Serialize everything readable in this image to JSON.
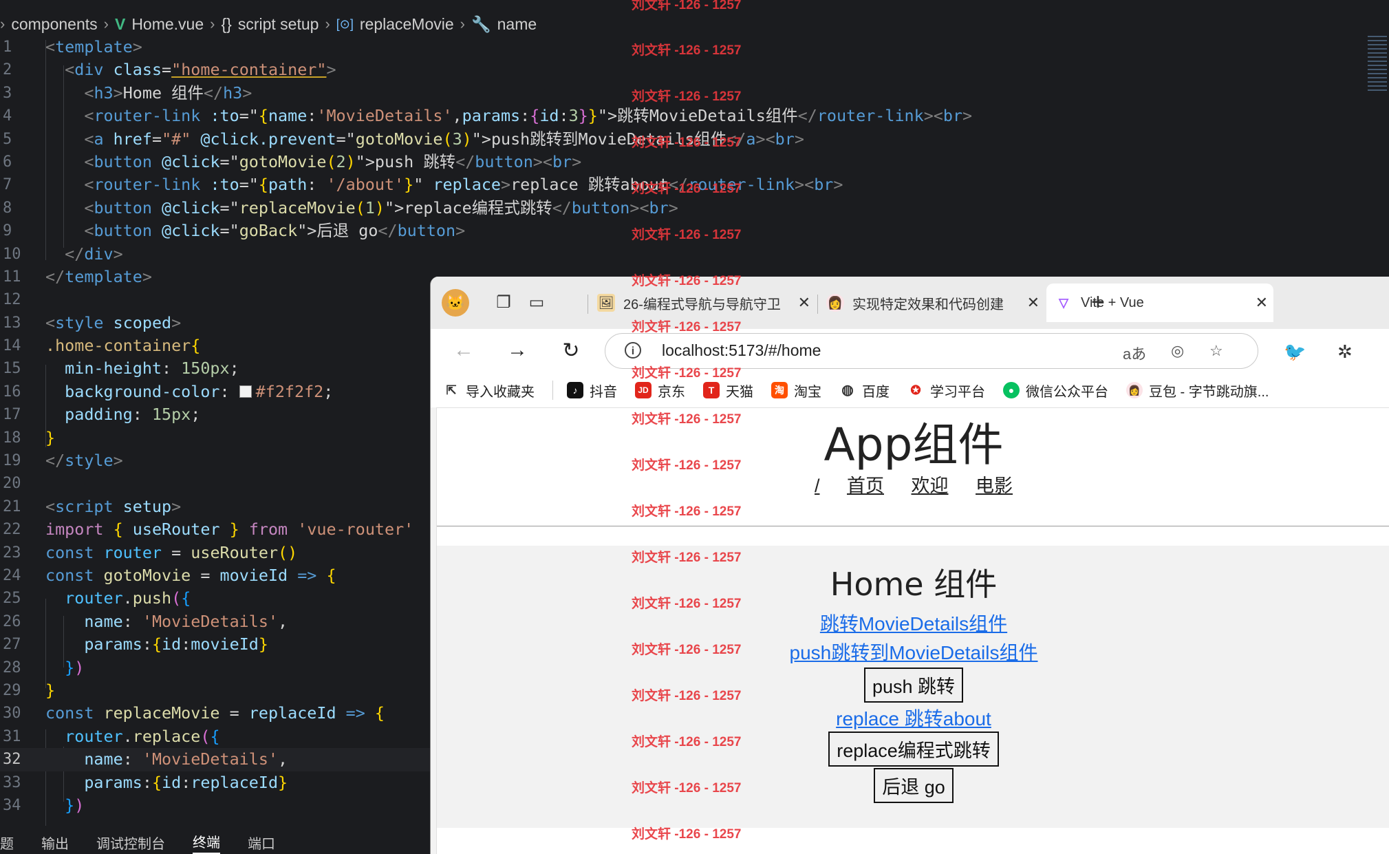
{
  "breadcrumb": {
    "items": [
      "components",
      "Home.vue",
      "script setup",
      "replaceMovie",
      "name"
    ]
  },
  "code_lines": [
    {
      "n": "1"
    },
    {
      "n": "2"
    },
    {
      "n": "3"
    },
    {
      "n": "4"
    },
    {
      "n": "5"
    },
    {
      "n": "6"
    },
    {
      "n": "7"
    },
    {
      "n": "8"
    },
    {
      "n": "9"
    },
    {
      "n": "10"
    },
    {
      "n": "11"
    },
    {
      "n": "12"
    },
    {
      "n": "13"
    },
    {
      "n": "14"
    },
    {
      "n": "15"
    },
    {
      "n": "16"
    },
    {
      "n": "17"
    },
    {
      "n": "18"
    },
    {
      "n": "19"
    },
    {
      "n": "20"
    },
    {
      "n": "21"
    },
    {
      "n": "22"
    },
    {
      "n": "23"
    },
    {
      "n": "24"
    },
    {
      "n": "25"
    },
    {
      "n": "26"
    },
    {
      "n": "27"
    },
    {
      "n": "28"
    },
    {
      "n": "29"
    },
    {
      "n": "30"
    },
    {
      "n": "31"
    },
    {
      "n": "32"
    },
    {
      "n": "33"
    },
    {
      "n": "34"
    }
  ],
  "code": {
    "l1": [
      "<",
      "template",
      ">"
    ],
    "l2": [
      "<",
      "div",
      "class",
      "=",
      "\"home-container\"",
      ">"
    ],
    "l3": [
      "<",
      "h3",
      ">",
      "Home 组件",
      "</",
      "h3",
      ">"
    ],
    "l4": [
      "<",
      "router-link",
      ":to",
      "=\"",
      "{",
      "name",
      ":",
      "'MovieDetails'",
      ",",
      "params",
      ":",
      "{",
      "id",
      ":",
      "3",
      "}",
      "}",
      "\">",
      "跳转MovieDetails组件",
      "</",
      "router-link",
      ">",
      "<",
      "br",
      ">"
    ],
    "l5": [
      "<",
      "a",
      "href",
      "=",
      "\"#\"",
      "@click.prevent",
      "=\"",
      "gotoMovie",
      "(",
      "3",
      ")",
      "\">",
      "push跳转到MovieDetails组件",
      "</",
      "a",
      ">",
      "<",
      "br",
      ">"
    ],
    "l6": [
      "<",
      "button",
      "@click",
      "=\"",
      "gotoMovie",
      "(",
      "2",
      ")",
      "\">",
      "push 跳转",
      "</",
      "button",
      ">",
      "<",
      "br",
      ">"
    ],
    "l7": [
      "<",
      "router-link",
      ":to",
      "=\"",
      "{",
      "path",
      ": ",
      "'/about'",
      "}",
      "\"",
      "replace",
      ">",
      "replace 跳转about",
      "</",
      "router-link",
      ">",
      "<",
      "br",
      ">"
    ],
    "l8": [
      "<",
      "button",
      "@click",
      "=\"",
      "replaceMovie",
      "(",
      "1",
      ")",
      "\">",
      "replace编程式跳转",
      "</",
      "button",
      ">",
      "<",
      "br",
      ">"
    ],
    "l9": [
      "<",
      "button",
      "@click",
      "=\"",
      "goBack",
      "\">",
      "后退 go",
      "</",
      "button",
      ">"
    ],
    "l10": [
      "</",
      "div",
      ">"
    ],
    "l11": [
      "</",
      "template",
      ">"
    ],
    "l13": [
      "<",
      "style",
      "scoped",
      ">"
    ],
    "l14": [
      ".home-container",
      "{"
    ],
    "l15": [
      "min-height",
      ": ",
      "150px",
      ";"
    ],
    "l16": [
      "background-color",
      ": ",
      "#f2f2f2",
      ";"
    ],
    "l17": [
      "padding",
      ": ",
      "15px",
      ";"
    ],
    "l18": [
      "}"
    ],
    "l19": [
      "</",
      "style",
      ">"
    ],
    "l21": [
      "<",
      "script",
      "setup",
      ">"
    ],
    "l22": [
      "import",
      "{",
      "useRouter",
      "}",
      "from",
      "'vue-router'"
    ],
    "l23": [
      "const",
      "router",
      "=",
      "useRouter",
      "()"
    ],
    "l24": [
      "const",
      "gotoMovie",
      "=",
      "movieId",
      "=>",
      "{"
    ],
    "l25": [
      "router",
      ".",
      "push",
      "(",
      "{"
    ],
    "l26": [
      "name",
      ": ",
      "'MovieDetails'",
      ","
    ],
    "l27": [
      "params",
      ":",
      "{",
      "id",
      ":",
      "movieId",
      "}"
    ],
    "l28": [
      "}",
      ")"
    ],
    "l29": [
      "}"
    ],
    "l30": [
      "const",
      "replaceMovie",
      "=",
      "replaceId",
      "=>",
      "{"
    ],
    "l31": [
      "router",
      ".",
      "replace",
      "(",
      "{"
    ],
    "l32": [
      "name",
      ": ",
      "'MovieDetails'",
      ","
    ],
    "l33": [
      "params",
      ":",
      "{",
      "id",
      ":",
      "replaceId",
      "}"
    ],
    "l34": [
      "}",
      ")"
    ]
  },
  "panel_tabs": [
    "题",
    "输出",
    "调试控制台",
    "终端",
    "端口"
  ],
  "watermark": "刘文轩 -126 - 1257",
  "browser": {
    "tabs": [
      {
        "title": "26-编程式导航与导航守卫"
      },
      {
        "title": "实现特定效果和代码创建"
      },
      {
        "title": "Vite + Vue"
      }
    ],
    "url": "localhost:5173/#/home",
    "aa_label": "aあ",
    "bookmarks": [
      {
        "label": "导入收藏夹"
      },
      {
        "label": "抖音"
      },
      {
        "label": "京东"
      },
      {
        "label": "天猫"
      },
      {
        "label": "淘宝"
      },
      {
        "label": "百度"
      },
      {
        "label": "学习平台"
      },
      {
        "label": "微信公众平台"
      },
      {
        "label": "豆包 - 字节跳动旗..."
      }
    ]
  },
  "page": {
    "app_title": "App组件",
    "nav": [
      "/",
      "首页",
      "欢迎",
      "电影"
    ],
    "home_title": "Home 组件",
    "link1": "跳转MovieDetails组件",
    "link2": "push跳转到MovieDetails组件",
    "btn_push": "push 跳转",
    "link3": "replace 跳转about",
    "btn_replace": "replace编程式跳转",
    "btn_back": "后退 go"
  },
  "colors": {
    "editor_bg": "#1b1c1f",
    "tag": "#569cd6",
    "attr": "#9cdcfe",
    "string": "#ce9178",
    "link": "#1a6ce8",
    "watermark": "#e8383d",
    "home_bg": "#f2f2f2"
  }
}
